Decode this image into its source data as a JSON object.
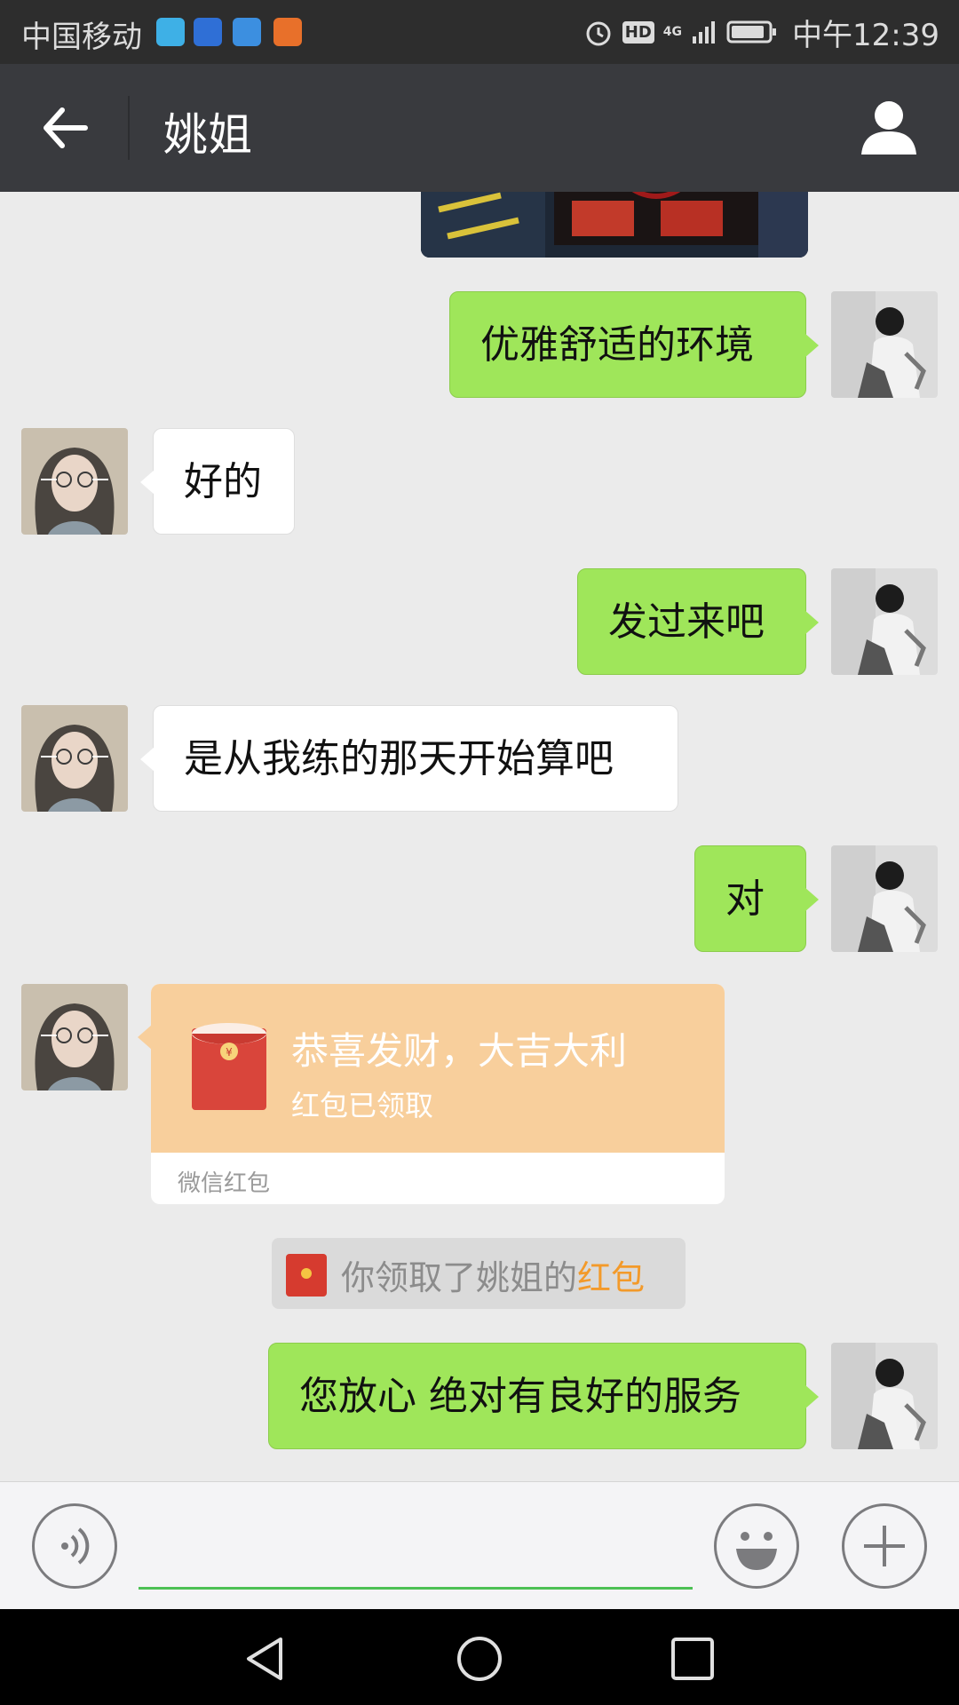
{
  "status_bar": {
    "carrier": "中国移动",
    "time": "中午12:39",
    "hd_badge": "HD",
    "network": "4G"
  },
  "title_bar": {
    "title": "姚姐"
  },
  "messages": [
    {
      "side": "right",
      "type": "text",
      "text": "优雅舒适的环境"
    },
    {
      "side": "left",
      "type": "text",
      "text": "好的"
    },
    {
      "side": "right",
      "type": "text",
      "text": "发过来吧"
    },
    {
      "side": "left",
      "type": "text",
      "text": "是从我练的那天开始算吧"
    },
    {
      "side": "right",
      "type": "text",
      "text": "对"
    },
    {
      "side": "right",
      "type": "text",
      "text": "您放心 绝对有良好的服务"
    }
  ],
  "red_packet": {
    "title": "恭喜发财，大吉大利",
    "status": "红包已领取",
    "footer": "微信红包"
  },
  "system_notice": {
    "text": "你领取了姚姐的",
    "link": "红包"
  },
  "colors": {
    "sent_bubble": "#9fe65a",
    "received_bubble": "#ffffff",
    "red_packet": "#f8cf9c",
    "title_bar": "#393a3e",
    "input_underline": "#4cc054"
  }
}
